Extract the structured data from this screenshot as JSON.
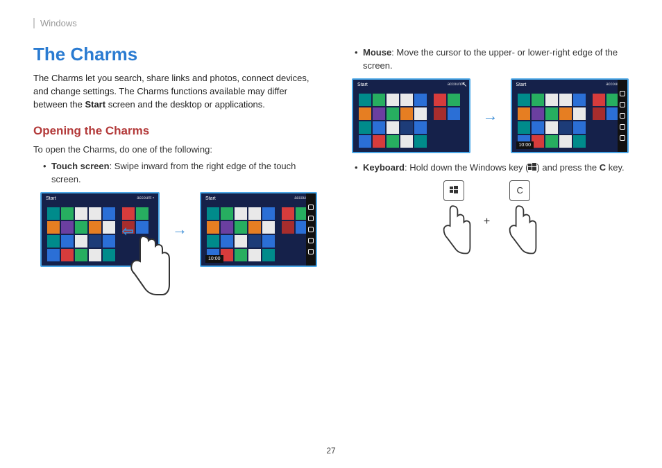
{
  "header": "Windows",
  "page_number": "27",
  "left": {
    "title": "The Charms",
    "intro_a": "The Charms let you search, share links and photos, connect devices, and change settings. The Charms functions available may differ between the ",
    "intro_bold": "Start",
    "intro_b": " screen and the desktop or applications.",
    "h2": "Opening the Charms",
    "open_text": "To open the Charms, do one of the following:",
    "touch_label": "Touch screen",
    "touch_text": ": Swipe inward from the right edge of the touch screen."
  },
  "right": {
    "mouse_label": "Mouse",
    "mouse_text": ": Move the cursor to the upper- or lower-right edge of the screen.",
    "keyboard_label": "Keyboard",
    "keyboard_text_a": ": Hold down the Windows key (",
    "keyboard_text_b": ") and press the ",
    "keyboard_key": "C",
    "keyboard_text_c": " key.",
    "key_c": "C",
    "plus": "+"
  },
  "start": {
    "label": "Start",
    "account": "account ▪",
    "time": "10:00"
  }
}
